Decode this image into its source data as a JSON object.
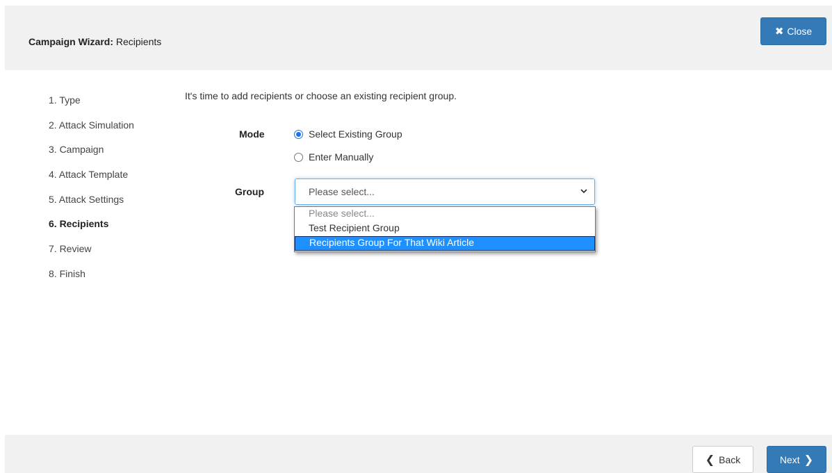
{
  "header": {
    "title_bold": "Campaign Wizard:",
    "title_rest": "Recipients",
    "close_label": "Close",
    "close_icon": "x-icon"
  },
  "steps": [
    {
      "label": "1. Type",
      "active": false
    },
    {
      "label": "2. Attack Simulation",
      "active": false
    },
    {
      "label": "3. Campaign",
      "active": false
    },
    {
      "label": "4. Attack Template",
      "active": false
    },
    {
      "label": "5. Attack Settings",
      "active": false
    },
    {
      "label": "6. Recipients",
      "active": true
    },
    {
      "label": "7. Review",
      "active": false
    },
    {
      "label": "8. Finish",
      "active": false
    }
  ],
  "main": {
    "intro": "It's time to add recipients or choose an existing recipient group.",
    "mode_label": "Mode",
    "mode_options": [
      {
        "label": "Select Existing Group",
        "checked": true
      },
      {
        "label": "Enter Manually",
        "checked": false
      }
    ],
    "group_label": "Group",
    "group_select": {
      "value": "Please select...",
      "options": [
        "Please select...",
        "Test Recipient Group",
        "Recipients Group For That Wiki Article"
      ],
      "highlighted": "Recipients Group For That Wiki Article"
    }
  },
  "footer": {
    "back_label": "Back",
    "next_label": "Next"
  },
  "colors": {
    "primary": "#337ab7",
    "highlight": "#1e90ff",
    "panel": "#f1f1f1"
  }
}
